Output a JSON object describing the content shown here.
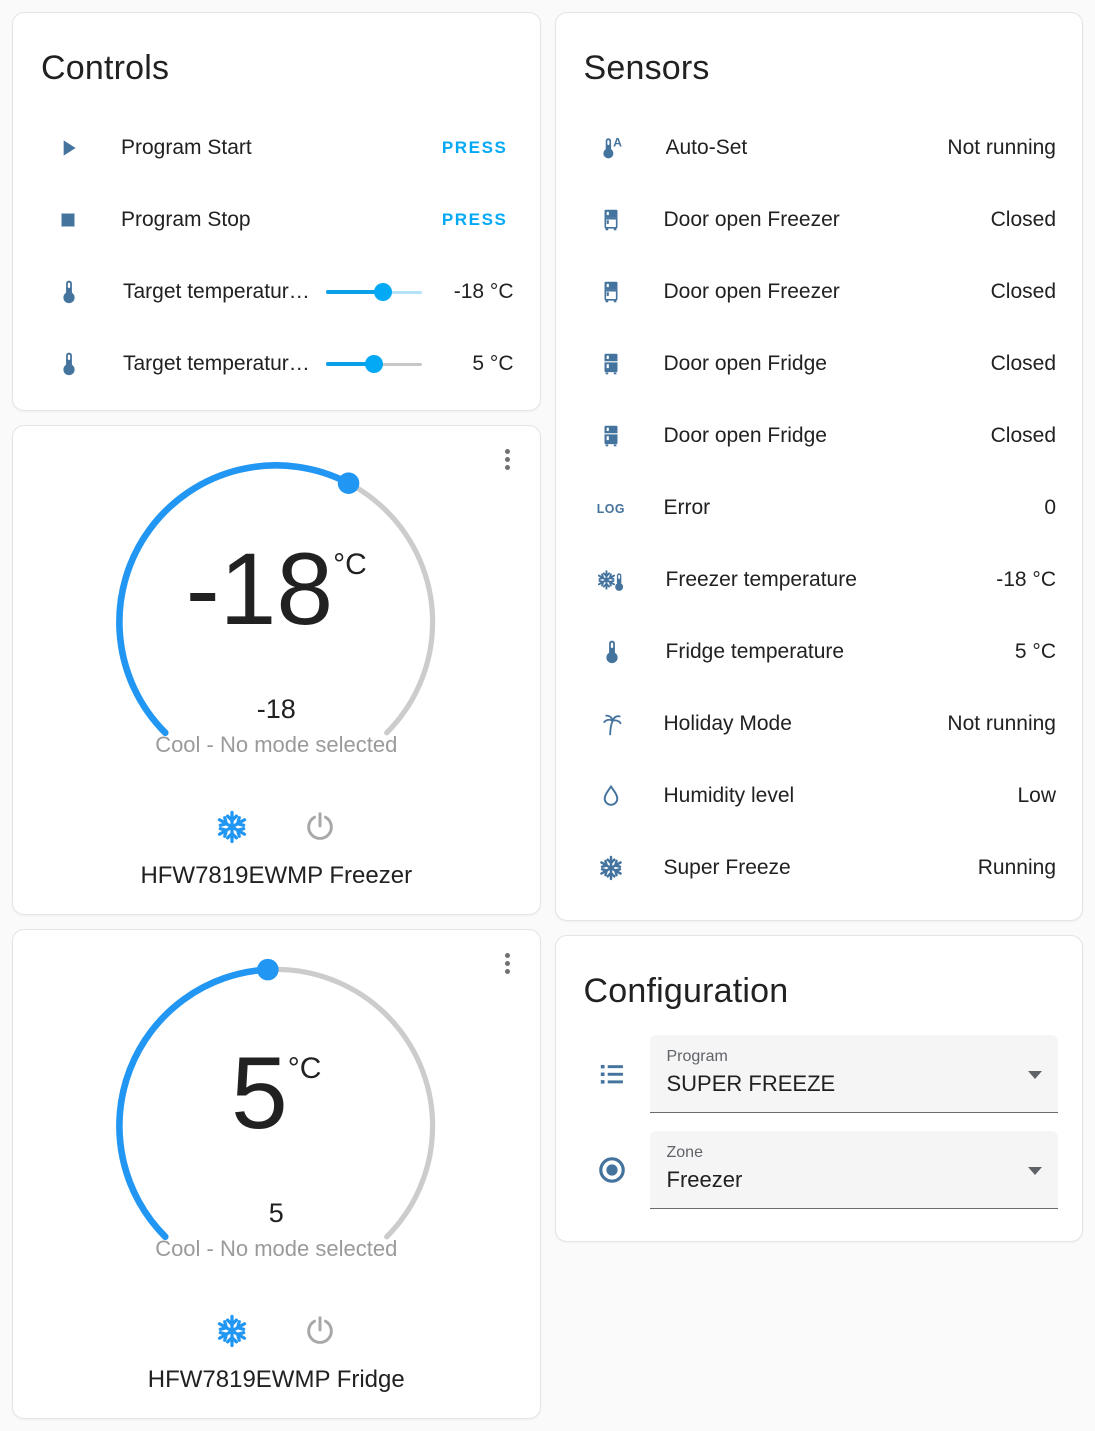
{
  "colors": {
    "accent": "#03a9f4",
    "icon": "#44739e",
    "dial_active": "#2196f3",
    "dial_track": "#cccccc",
    "secondary_text": "#9a9a9a"
  },
  "controls": {
    "title": "Controls",
    "rows": [
      {
        "icon": "play-icon",
        "label": "Program Start",
        "action": "PRESS"
      },
      {
        "icon": "stop-icon",
        "label": "Program Stop",
        "action": "PRESS"
      },
      {
        "icon": "thermometer-icon",
        "label": "Target temperatur…",
        "value": "-18 °C",
        "slider_percent": 60
      },
      {
        "icon": "thermometer-icon",
        "label": "Target temperatur…",
        "value": "5 °C",
        "slider_percent": 50
      }
    ]
  },
  "sensors": {
    "title": "Sensors",
    "rows": [
      {
        "icon": "thermometer-auto-icon",
        "label": "Auto-Set",
        "value": "Not running"
      },
      {
        "icon": "fridge-top-icon",
        "label": "Door open Freezer",
        "value": "Closed"
      },
      {
        "icon": "fridge-top-icon",
        "label": "Door open Freezer",
        "value": "Closed"
      },
      {
        "icon": "fridge-bottom-icon",
        "label": "Door open Fridge",
        "value": "Closed"
      },
      {
        "icon": "fridge-bottom-icon",
        "label": "Door open Fridge",
        "value": "Closed"
      },
      {
        "icon": "log-icon",
        "label": "Error",
        "value": "0"
      },
      {
        "icon": "snowflake-thermometer-icon",
        "label": "Freezer temperature",
        "value": "-18 °C"
      },
      {
        "icon": "thermometer-icon",
        "label": "Fridge temperature",
        "value": "5 °C"
      },
      {
        "icon": "palm-tree-icon",
        "label": "Holiday Mode",
        "value": "Not running"
      },
      {
        "icon": "water-drop-icon",
        "label": "Humidity level",
        "value": "Low"
      },
      {
        "icon": "snowflake-icon",
        "label": "Super Freeze",
        "value": "Running"
      }
    ]
  },
  "thermostats": {
    "freezer": {
      "current": "-18",
      "unit": "°C",
      "target": "-18",
      "status": "Cool - No mode selected",
      "name": "HFW7819EWMP Freezer",
      "dial_percent": 60,
      "mode_icons": [
        "snowflake-icon",
        "power-icon"
      ]
    },
    "fridge": {
      "current": "5",
      "unit": "°C",
      "target": "5",
      "status": "Cool - No mode selected",
      "name": "HFW7819EWMP Fridge",
      "dial_percent": 49,
      "mode_icons": [
        "snowflake-icon",
        "power-icon"
      ]
    }
  },
  "configuration": {
    "title": "Configuration",
    "fields": [
      {
        "icon": "list-icon",
        "label": "Program",
        "value": "SUPER FREEZE"
      },
      {
        "icon": "radio-icon",
        "label": "Zone",
        "value": "Freezer"
      }
    ]
  }
}
